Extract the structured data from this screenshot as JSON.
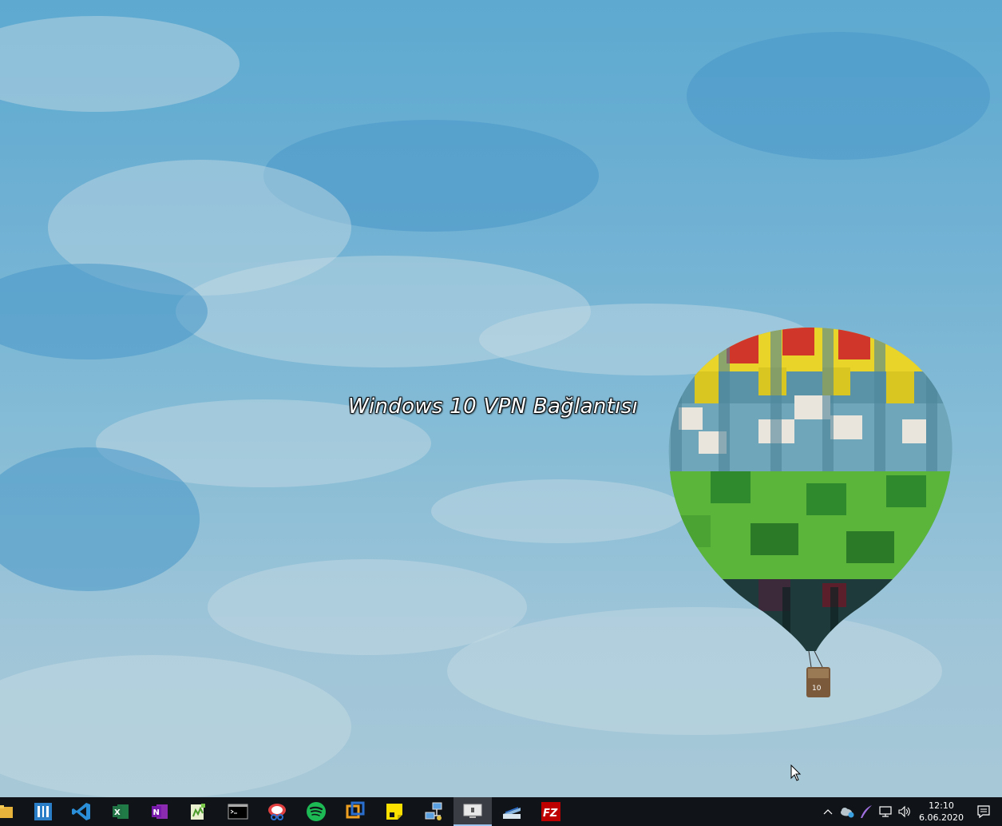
{
  "desktop": {
    "overlay_text": "Windows 10 VPN Bağlantısı",
    "balloon_label": "10"
  },
  "taskbar": {
    "apps": [
      {
        "name": "file-explorer-icon"
      },
      {
        "name": "app-store-icon"
      },
      {
        "name": "vs-code-icon"
      },
      {
        "name": "excel-icon",
        "letter": "X"
      },
      {
        "name": "onenote-icon",
        "letter": "N"
      },
      {
        "name": "notepad-plus-icon"
      },
      {
        "name": "terminal-icon"
      },
      {
        "name": "snipping-tool-icon"
      },
      {
        "name": "spotify-icon"
      },
      {
        "name": "virtualbox-icon"
      },
      {
        "name": "sticky-notes-icon"
      },
      {
        "name": "network-tool-icon"
      },
      {
        "name": "remote-desktop-icon",
        "active": true
      },
      {
        "name": "scanner-icon"
      },
      {
        "name": "filezilla-icon",
        "letter": "FZ"
      }
    ],
    "tray": {
      "time": "12:10",
      "date": "6.06.2020"
    }
  },
  "colors": {
    "taskbar_bg": "#101418",
    "sky": "#6eb0d3"
  }
}
